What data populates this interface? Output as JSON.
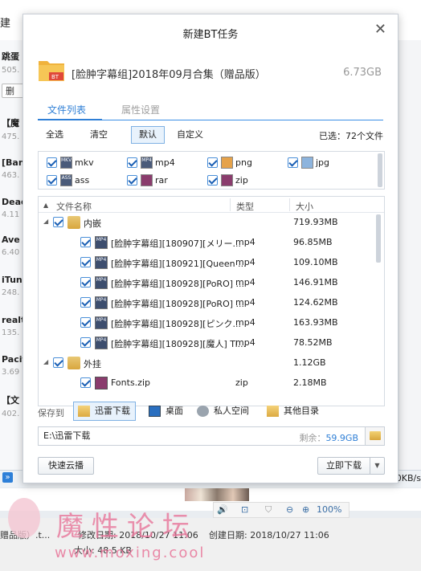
{
  "background": {
    "title_fragment": "建",
    "list": [
      {
        "title": "跳蛋",
        "sub": "505."
      },
      {
        "title": "【魔",
        "sub": "475."
      },
      {
        "title": "[Ban",
        "sub": "463."
      },
      {
        "title": "Dead",
        "sub": "4.11"
      },
      {
        "title": "Ave",
        "sub": "6.40"
      },
      {
        "title": "iTun",
        "sub": "248."
      },
      {
        "title": "realt",
        "sub": "135."
      },
      {
        "title": "Pacit",
        "sub": "3.69"
      },
      {
        "title": "【文",
        "sub": "402."
      }
    ],
    "delete_label": "删",
    "speed": "0KB/s",
    "player": {
      "volume_icon": "🔊",
      "zoom": "100%"
    },
    "props": {
      "name_tail": "赠品版）.t...",
      "modified": "修改日期: 2018/10/27 11:06",
      "created": "创建日期: 2018/10/27 11:06",
      "size": "大小: 48.5 KB"
    },
    "watermark": {
      "text": "魔性论坛",
      "url": "www.moxing.cool"
    }
  },
  "dialog": {
    "title": "新建BT任务",
    "close": "✕",
    "task_name": "[脸肿字幕组]2018年09月合集（赠品版）",
    "task_size": "6.73GB",
    "tabs": [
      "文件列表",
      "属性设置"
    ],
    "filters": [
      "全选",
      "清空",
      "默认",
      "自定义"
    ],
    "selected_count": "已选：72个文件",
    "types": [
      {
        "label": "mkv",
        "icon": "video-icon"
      },
      {
        "label": "mp4",
        "icon": "video-icon"
      },
      {
        "label": "png",
        "icon": "image-icon"
      },
      {
        "label": "jpg",
        "icon": "image-icon"
      },
      {
        "label": "ass",
        "icon": "subtitle-icon"
      },
      {
        "label": "rar",
        "icon": "archive-icon"
      },
      {
        "label": "zip",
        "icon": "archive-icon"
      }
    ],
    "tree_header": {
      "name": "文件名称",
      "type": "类型",
      "size": "大小"
    },
    "tree_rows": [
      {
        "level": 0,
        "name": "内嵌",
        "type": "",
        "size": "719.93MB",
        "kind": "folder"
      },
      {
        "level": 1,
        "name": "[脸肿字幕组][180907][メリー...",
        "type": "mp4",
        "size": "96.85MB",
        "kind": "video"
      },
      {
        "level": 1,
        "name": "[脸肿字幕组][180921][Queen ...",
        "type": "mp4",
        "size": "109.10MB",
        "kind": "video"
      },
      {
        "level": 1,
        "name": "[脸肿字幕组][180928][PoRO] ...",
        "type": "mp4",
        "size": "146.91MB",
        "kind": "video"
      },
      {
        "level": 1,
        "name": "[脸肿字幕组][180928][PoRO] ...",
        "type": "mp4",
        "size": "124.62MB",
        "kind": "video"
      },
      {
        "level": 1,
        "name": "[脸肿字幕组][180928][ピンク...",
        "type": "mp4",
        "size": "163.93MB",
        "kind": "video"
      },
      {
        "level": 1,
        "name": "[脸肿字幕组][180928][魔人] Ti...",
        "type": "mp4",
        "size": "78.52MB",
        "kind": "video"
      },
      {
        "level": 0,
        "name": "外挂",
        "type": "",
        "size": "1.12GB",
        "kind": "folder"
      },
      {
        "level": 1,
        "name": "Fonts.zip",
        "type": "zip",
        "size": "2.18MB",
        "kind": "archive"
      }
    ],
    "save_label": "保存到",
    "locations": [
      "迅雷下载",
      "桌面",
      "私人空间",
      "其他目录"
    ],
    "path_value": "E:\\迅雷下载",
    "remain_label": "剩余：",
    "remain_value": "59.9GB",
    "cloud_button": "快速云播",
    "download_button": "立即下载"
  }
}
